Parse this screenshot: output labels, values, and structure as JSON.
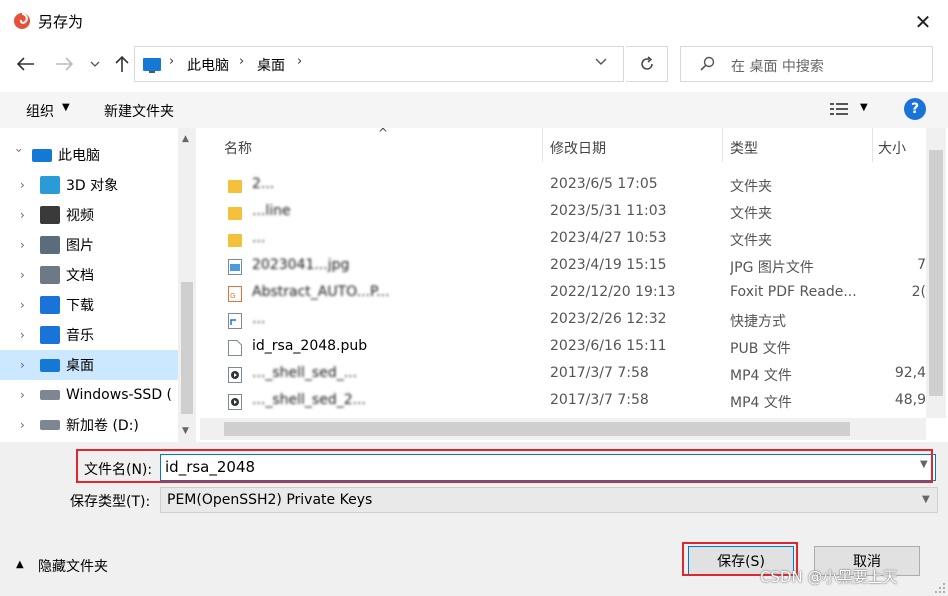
{
  "window": {
    "title": "另存为",
    "close_label": "✕"
  },
  "breadcrumb": {
    "root": "此电脑",
    "current": "桌面"
  },
  "search": {
    "placeholder": "在 桌面 中搜索"
  },
  "toolbar": {
    "organize_label": "组织",
    "new_folder_label": "新建文件夹",
    "help_label": "?"
  },
  "sidebar": {
    "items": [
      {
        "label": "此电脑",
        "icon": "pc-icon",
        "color": "#1479d4"
      },
      {
        "label": "3D 对象",
        "icon": "3d-objects-icon",
        "color": "#2b9bd8"
      },
      {
        "label": "视频",
        "icon": "video-icon",
        "color": "#3a3a3a"
      },
      {
        "label": "图片",
        "icon": "pictures-icon",
        "color": "#5b6c7d"
      },
      {
        "label": "文档",
        "icon": "documents-icon",
        "color": "#6d7a86"
      },
      {
        "label": "下载",
        "icon": "downloads-icon",
        "color": "#1a73d9"
      },
      {
        "label": "音乐",
        "icon": "music-icon",
        "color": "#1a73d9"
      },
      {
        "label": "桌面",
        "icon": "desktop-icon",
        "color": "#1479d4"
      },
      {
        "label": "Windows-SSD (",
        "icon": "drive-icon",
        "color": "#7c8791"
      },
      {
        "label": "新加卷 (D:)",
        "icon": "drive-icon",
        "color": "#7c8791"
      }
    ]
  },
  "columns": {
    "name": "名称",
    "date": "修改日期",
    "type": "类型",
    "size": "大小"
  },
  "files": [
    {
      "name": "2...",
      "date": "2023/6/5 17:05",
      "type": "文件夹",
      "size": "",
      "icon": "folder-icon"
    },
    {
      "name": "...line",
      "date": "2023/5/31 11:03",
      "type": "文件夹",
      "size": "",
      "icon": "folder-icon"
    },
    {
      "name": "...",
      "date": "2023/4/27 10:53",
      "type": "文件夹",
      "size": "",
      "icon": "folder-icon"
    },
    {
      "name": "2023041...jpg",
      "date": "2023/4/19 15:15",
      "type": "JPG 图片文件",
      "size": "7",
      "icon": "image-file-icon"
    },
    {
      "name": "Abstract_AUTO...P...",
      "date": "2022/12/20 19:13",
      "type": "Foxit PDF Reade...",
      "size": "2(",
      "icon": "pdf-icon"
    },
    {
      "name": "...",
      "date": "2023/2/26 12:32",
      "type": "快捷方式",
      "size": "",
      "icon": "shortcut-icon"
    },
    {
      "name": "id_rsa_2048.pub",
      "date": "2023/6/16 15:11",
      "type": "PUB 文件",
      "size": "",
      "icon": "file-icon"
    },
    {
      "name": "..._shell_sed_...",
      "date": "2017/3/7 7:58",
      "type": "MP4 文件",
      "size": "92,4",
      "icon": "video-file-icon"
    },
    {
      "name": "..._shell_sed_2...",
      "date": "2017/3/7 7:58",
      "type": "MP4 文件",
      "size": "48,9",
      "icon": "video-file-icon"
    }
  ],
  "form": {
    "filename_label": "文件名(N):",
    "filename_value": "id_rsa_2048",
    "filetype_label": "保存类型(T):",
    "filetype_value": "PEM(OpenSSH2) Private Keys"
  },
  "footer": {
    "hide_folders_label": "隐藏文件夹",
    "save_label": "保存(S)",
    "cancel_label": "取消",
    "watermark": "CSDN @小黑要上天"
  },
  "colors": {
    "accent": "#0078d7",
    "highlight_red": "#e0262f",
    "selected_bg": "#cce8ff"
  }
}
